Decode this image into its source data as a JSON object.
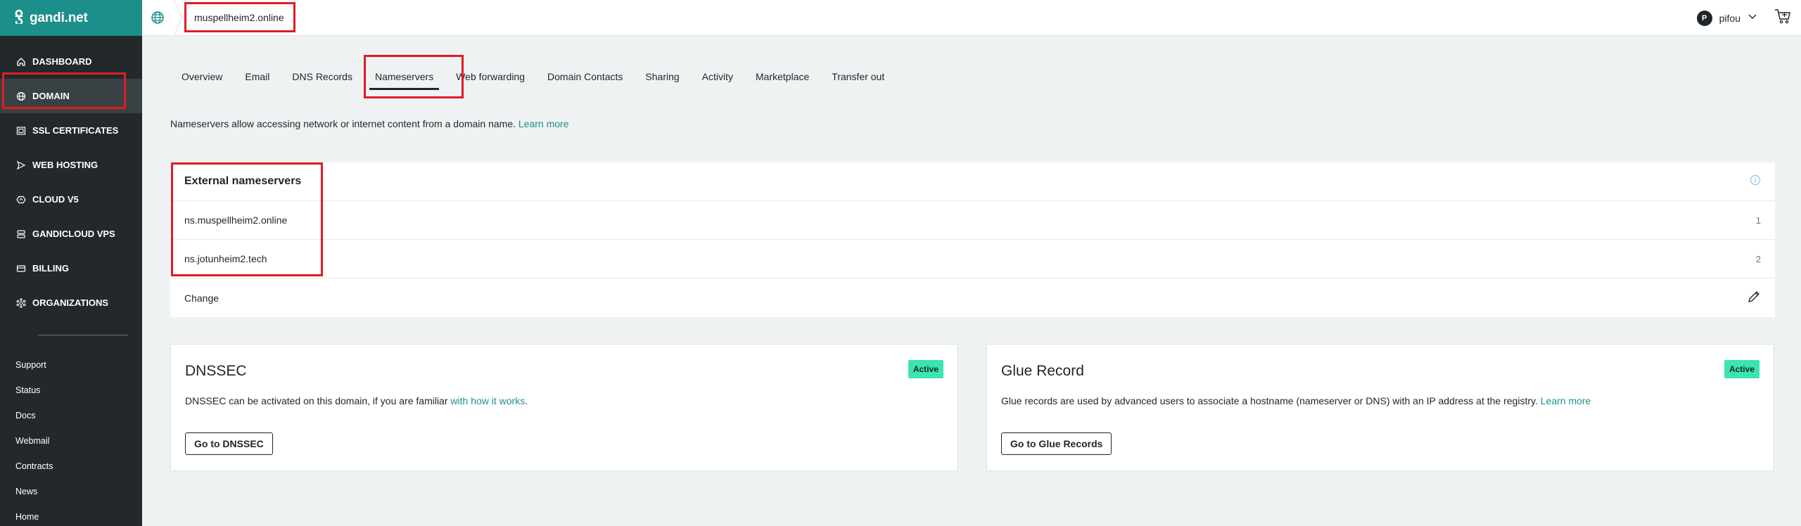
{
  "app": {
    "logo_text": "gandi.net"
  },
  "sidebar": {
    "items": [
      {
        "label": "DASHBOARD",
        "icon": "home-icon"
      },
      {
        "label": "DOMAIN",
        "icon": "globe-icon",
        "active": true
      },
      {
        "label": "SSL CERTIFICATES",
        "icon": "certificate-icon"
      },
      {
        "label": "WEB HOSTING",
        "icon": "send-icon"
      },
      {
        "label": "CLOUD V5",
        "icon": "cloud-icon"
      },
      {
        "label": "GANDICLOUD VPS",
        "icon": "server-icon"
      },
      {
        "label": "BILLING",
        "icon": "credit-card-icon"
      },
      {
        "label": "ORGANIZATIONS",
        "icon": "organization-icon"
      }
    ],
    "links": [
      "Support",
      "Status",
      "Docs",
      "Webmail",
      "Contracts",
      "News",
      "Home"
    ]
  },
  "topbar": {
    "domain": "muspellheim2.online",
    "user_initial": "P",
    "user_name": "pifou"
  },
  "tabs": [
    {
      "label": "Overview"
    },
    {
      "label": "Email"
    },
    {
      "label": "DNS Records"
    },
    {
      "label": "Nameservers",
      "active": true
    },
    {
      "label": "Web forwarding"
    },
    {
      "label": "Domain Contacts"
    },
    {
      "label": "Sharing"
    },
    {
      "label": "Activity"
    },
    {
      "label": "Marketplace"
    },
    {
      "label": "Transfer out"
    }
  ],
  "intro": {
    "text": "Nameservers allow accessing network or internet content from a domain name. ",
    "link": "Learn more"
  },
  "nameservers": {
    "title": "External nameservers",
    "entries": [
      {
        "host": "ns.muspellheim2.online",
        "index": "1"
      },
      {
        "host": "ns.jotunheim2.tech",
        "index": "2"
      }
    ],
    "change_label": "Change"
  },
  "dnssec": {
    "title": "DNSSEC",
    "status": "Active",
    "desc": "DNSSEC can be activated on this domain, if you are familiar ",
    "link": "with how it works",
    "desc_end": ".",
    "button": "Go to DNSSEC"
  },
  "glue": {
    "title": "Glue Record",
    "status": "Active",
    "desc": "Glue records are used by advanced users to associate a hostname (nameserver or DNS) with an IP address at the registry. ",
    "link": "Learn more",
    "button": "Go to Glue Records"
  },
  "colors": {
    "brand": "#1c8f8a",
    "sidebar": "#23292b",
    "badge": "#3be4b0",
    "highlight": "#e01b24"
  }
}
